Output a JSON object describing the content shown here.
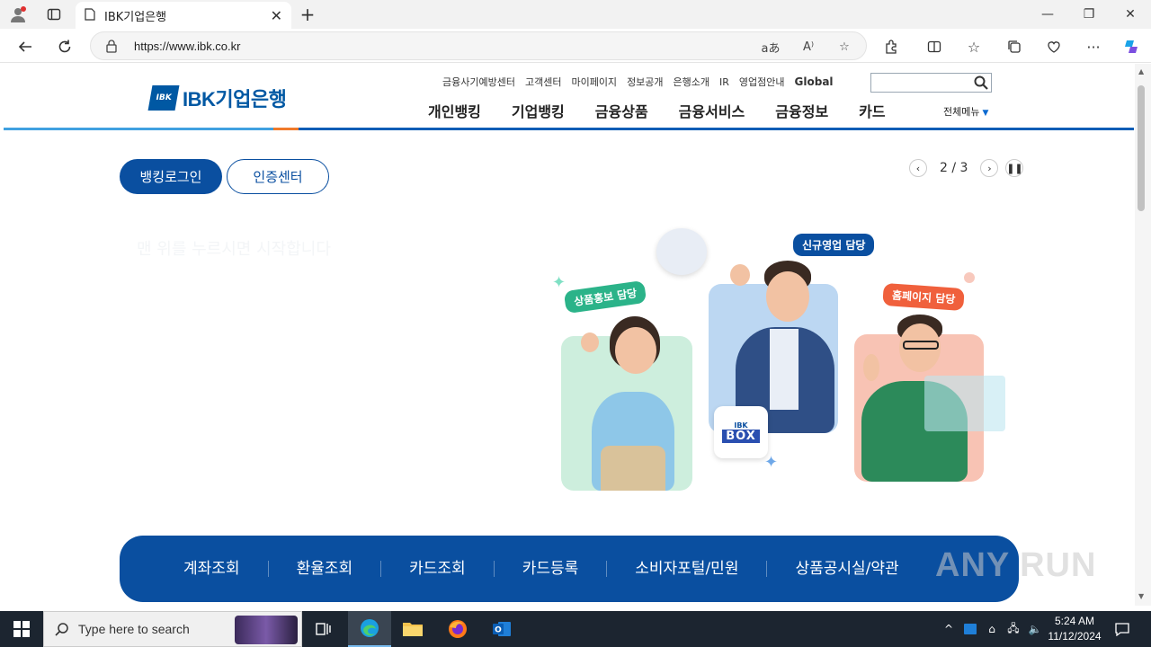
{
  "browser": {
    "tab_title": "IBK기업은행",
    "url": "https://www.ibk.co.kr",
    "window_controls": [
      "minimize",
      "restore",
      "close"
    ]
  },
  "site": {
    "logo_mark": "IBK",
    "logo_text": "IBK기업은행",
    "util_links": [
      "금융사기예방센터",
      "고객센터",
      "마이페이지",
      "정보공개",
      "은행소개",
      "IR",
      "영업점안내"
    ],
    "global_label": "Global",
    "gnb": [
      "개인뱅킹",
      "기업뱅킹",
      "금융상품",
      "금융서비스",
      "금융정보",
      "카드"
    ],
    "all_menu_label": "전체메뉴",
    "login_button": "뱅킹로그인",
    "cert_button": "인증센터",
    "pager": {
      "current": "2",
      "total": "3",
      "label": "2 / 3"
    },
    "faint_text": "맨 위를 누르시면 시작합니다",
    "illustration": {
      "tag_left": "상품홍보 담당",
      "tag_center": "신규영업 담당",
      "tag_right": "홈페이지 담당",
      "box_top": "IBK",
      "box_bottom": "BOX"
    },
    "quick_menu": [
      "계좌조회",
      "환율조회",
      "카드조회",
      "카드등록",
      "소비자포털/민원",
      "상품공시실/약관"
    ]
  },
  "taskbar": {
    "search_placeholder": "Type here to search",
    "time": "5:24 AM",
    "date": "11/12/2024"
  },
  "watermark": "ANY RUN",
  "colors": {
    "ibk_blue": "#0a4fa0",
    "accent_orange": "#f07a2a",
    "tag_green": "#2bb389",
    "tag_navy": "#0a4fa0",
    "tag_orange": "#f0603c"
  }
}
